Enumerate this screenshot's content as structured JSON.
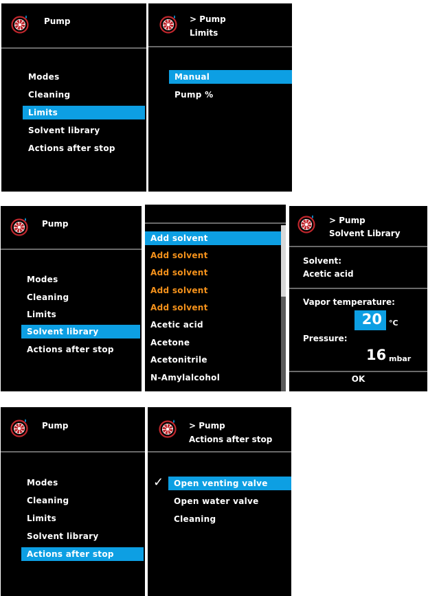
{
  "colors": {
    "selection": "#0d9fe3",
    "panel_bg": "#000000",
    "orange_item": "#f5921b",
    "divider": "#6a6a6a"
  },
  "icon": "pump-fan-icon",
  "row1": {
    "menu": {
      "title": "Pump",
      "items": [
        "Modes",
        "Cleaning",
        "Limits",
        "Solvent library",
        "Actions after stop"
      ],
      "selected": "Limits"
    },
    "limits": {
      "crumb": "> Pump",
      "title": "Limits",
      "items": [
        "Manual",
        "Pump %"
      ],
      "selected": "Manual"
    }
  },
  "row2": {
    "menu": {
      "title": "Pump",
      "items": [
        "Modes",
        "Cleaning",
        "Limits",
        "Solvent library",
        "Actions after stop"
      ],
      "selected": "Solvent library"
    },
    "list": {
      "items": [
        "Add solvent",
        "Add solvent",
        "Add solvent",
        "Add solvent",
        "Add solvent",
        "Acetic acid",
        "Acetone",
        "Acetonitrile",
        "N-Amylalcohol"
      ]
    },
    "solvent": {
      "crumb": "> Pump",
      "title": "Solvent Library",
      "solvent_label": "Solvent:",
      "solvent_value": "Acetic acid",
      "vapor_label": "Vapor temperature:",
      "vapor_value": "20",
      "vapor_unit": "°C",
      "pressure_label": "Pressure:",
      "pressure_value": "16",
      "pressure_unit": "mbar",
      "ok": "OK"
    }
  },
  "row3": {
    "menu": {
      "title": "Pump",
      "items": [
        "Modes",
        "Cleaning",
        "Limits",
        "Solvent library",
        "Actions after stop"
      ],
      "selected": "Actions after stop"
    },
    "actions": {
      "crumb": "> Pump",
      "title": "Actions after stop",
      "items": [
        "Open venting valve",
        "Open water valve",
        "Cleaning"
      ],
      "checked": "Open venting valve",
      "check_mark": "✓"
    }
  }
}
